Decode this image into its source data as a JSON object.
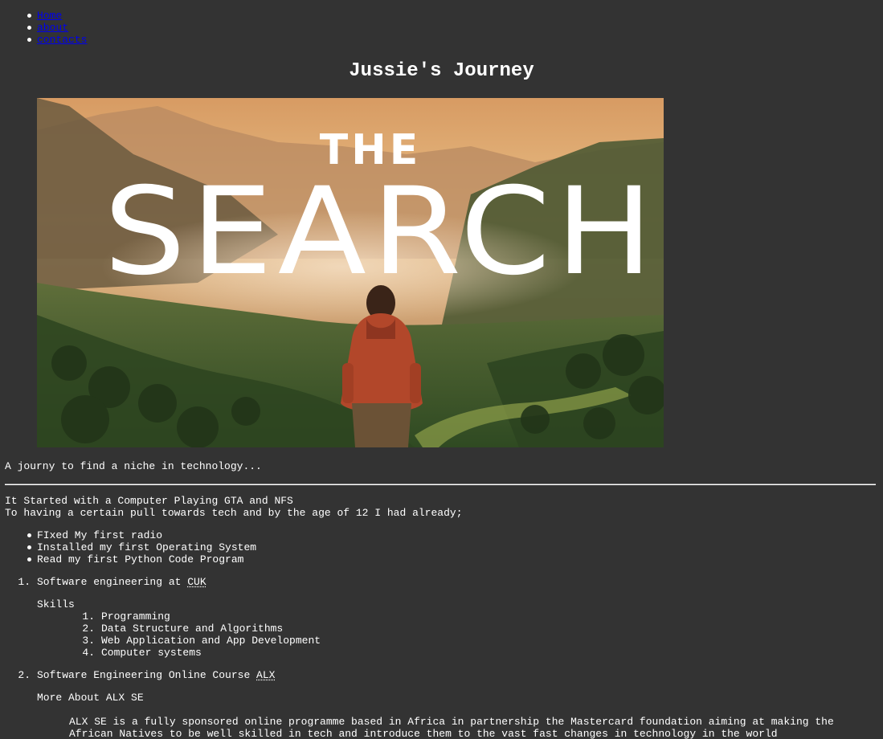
{
  "nav": {
    "items": [
      {
        "label": "Home"
      },
      {
        "label": "about"
      },
      {
        "label": "contacts"
      }
    ]
  },
  "page_title": "Jussie's Journey",
  "hero": {
    "overlay_small": "THE",
    "overlay_large": "SEARCH",
    "colors": {
      "sky": "#e9b97a",
      "forest": "#3f5a2c",
      "text": "#ffffff",
      "hoodie": "#b2472a"
    }
  },
  "tagline": "A journy to find a niche in technology...",
  "intro": {
    "line1": "It Started with a Computer Playing GTA and NFS",
    "line2": "To having a certain pull towards tech and by the age of 12 I had already;"
  },
  "achievements": [
    "FIxed My first radio",
    "Installed my first Operating System",
    "Read my first Python Code Program"
  ],
  "education": [
    {
      "number": "1.",
      "text_before": "Software engineering at ",
      "abbr": "CUK",
      "subheading": "Skills",
      "skills": [
        {
          "number": "1.",
          "label": "Programming"
        },
        {
          "number": "2.",
          "label": "Data Structure and Algorithms"
        },
        {
          "number": "3.",
          "label": "Web Application and App Development"
        },
        {
          "number": "4.",
          "label": "Computer systems"
        }
      ]
    },
    {
      "number": "2.",
      "text_before": "Software Engineering Online Course ",
      "abbr": "ALX",
      "subheading": "More About ALX SE",
      "description_line1": "ALX SE is a fully sponsored online programme based in Africa in partnership the Mastercard foundation aiming at making the",
      "description_line2": "African Natives to be well skilled in tech and introduce them to the vast fast changes in technology in the world"
    }
  ]
}
